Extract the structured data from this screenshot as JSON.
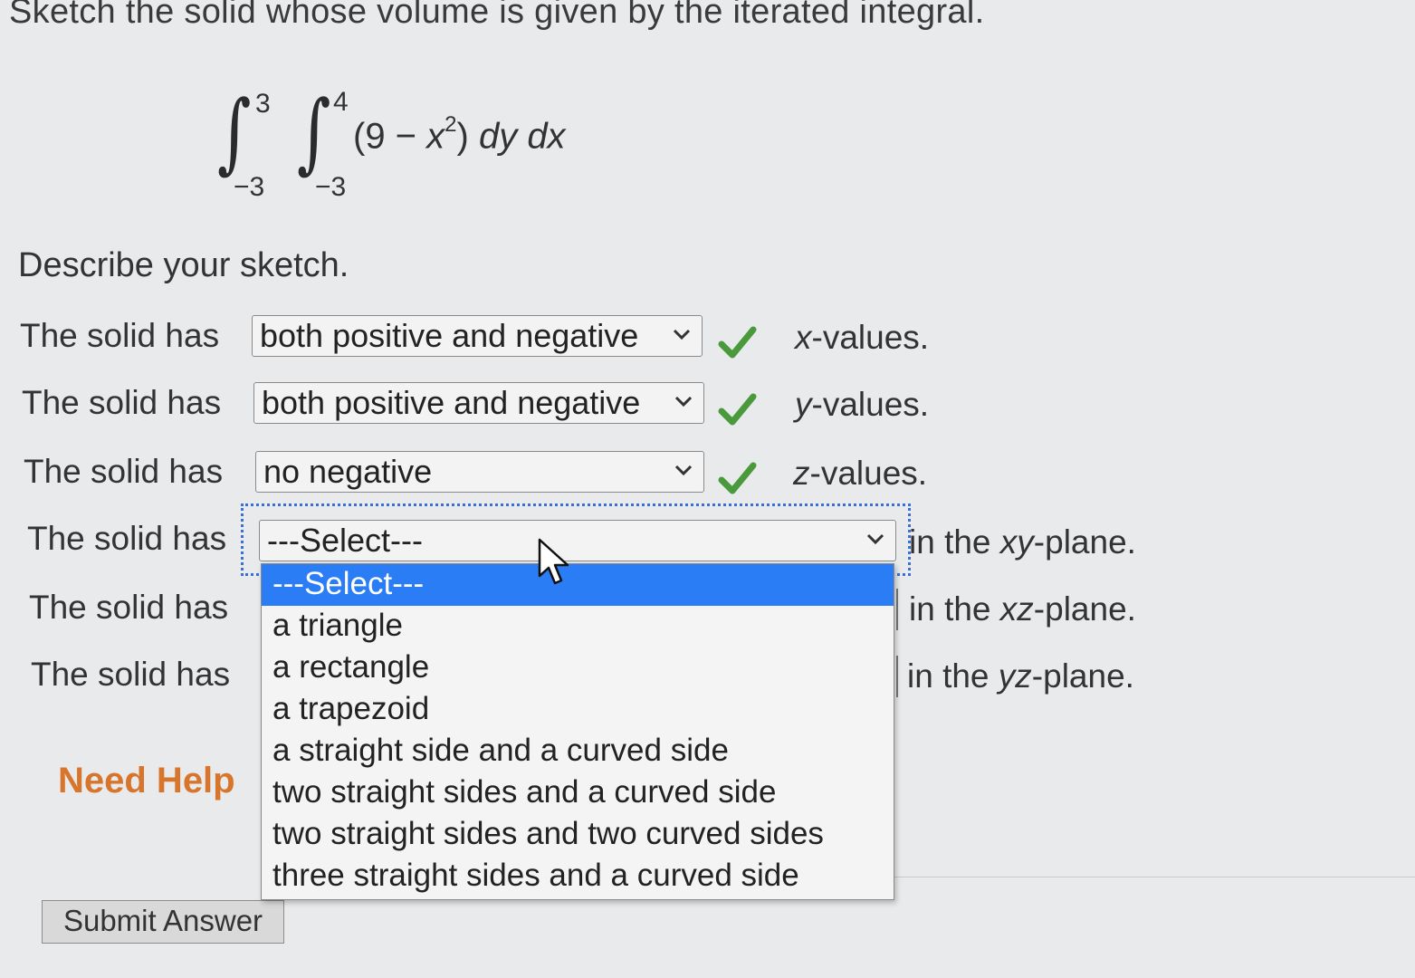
{
  "question": {
    "title": "Sketch the solid whose volume is given by the iterated integral.",
    "integral": {
      "outer_upper": "3",
      "outer_lower": "−3",
      "inner_upper": "4",
      "inner_lower": "−3",
      "integrand_open": "(9 − ",
      "integrand_var": "x",
      "integrand_exp": "2",
      "integrand_close": ") ",
      "differentials": "dy dx"
    },
    "prompt": "Describe your sketch."
  },
  "rows": [
    {
      "prefix": "The solid has",
      "selected": "both positive and negative",
      "suffix_var": "x",
      "suffix_rest": "-values.",
      "correct": true
    },
    {
      "prefix": "The solid has",
      "selected": "both positive and negative",
      "suffix_var": "y",
      "suffix_rest": "-values.",
      "correct": true
    },
    {
      "prefix": "The solid has",
      "selected": "no negative",
      "suffix_var": "z",
      "suffix_rest": "-values.",
      "correct": true
    },
    {
      "prefix": "The solid has",
      "selected": "---Select---",
      "suffix_pre": "in the ",
      "suffix_var": "xy",
      "suffix_rest": "-plane."
    },
    {
      "prefix": "The solid has",
      "suffix_pre": "in the ",
      "suffix_var": "xz",
      "suffix_rest": "-plane."
    },
    {
      "prefix": "The solid has",
      "suffix_pre": "in the ",
      "suffix_var": "yz",
      "suffix_rest": "-plane."
    }
  ],
  "dropdown": {
    "options": [
      "---Select---",
      "a triangle",
      "a rectangle",
      "a trapezoid",
      "a straight side and a curved side",
      "two straight sides and a curved side",
      "two straight sides and two curved sides",
      "three straight sides and a curved side"
    ],
    "highlighted_index": 0
  },
  "help": {
    "label": "Need Help"
  },
  "submit": {
    "label": "Submit Answer"
  },
  "colors": {
    "check": "#4a9a3c",
    "highlight": "#2a7df4",
    "need_help": "#d8752c",
    "focus_ring": "#3b6fd8"
  },
  "icons": [
    "chevron-down-icon",
    "checkmark-icon",
    "mouse-pointer-icon"
  ]
}
